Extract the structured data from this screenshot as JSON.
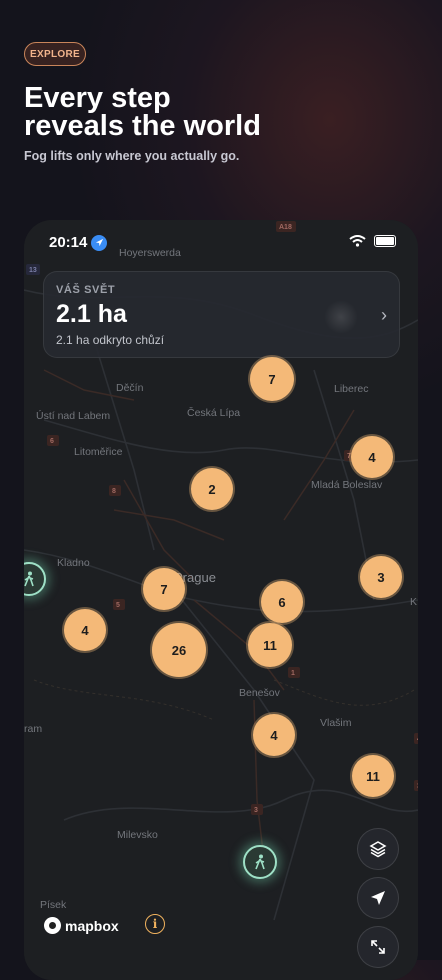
{
  "promo": {
    "badge": "EXPLORE",
    "headline_line1": "Every step",
    "headline_line2": "reveals the world",
    "subline": "Fog lifts only where you actually go."
  },
  "status_bar": {
    "time": "20:14"
  },
  "stats_card": {
    "label": "VÁŠ SVĚT",
    "value": "2.1 ha",
    "sub": "2.1 ha odkryto chůzí"
  },
  "map": {
    "places": [
      "Hoyerswerda",
      "Děčín",
      "Česká Lípa",
      "Liberec",
      "Ústí nad Labem",
      "Litoměřice",
      "Mladá Boleslav",
      "Kladno",
      "Prague",
      "Benešov",
      "Vlašim",
      "Milevsko",
      "Písek",
      "ram",
      "K"
    ],
    "road_labels": [
      "A18",
      "13",
      "6",
      "8",
      "7",
      "5",
      "1",
      "3",
      "4",
      "3"
    ],
    "clusters": [
      "7",
      "4",
      "2",
      "7",
      "3",
      "6",
      "4",
      "26",
      "11",
      "4",
      "11"
    ]
  },
  "attribution": {
    "brand": "mapbox",
    "info_glyph": "i"
  },
  "controls": {
    "layers": "layers-icon",
    "locate": "location-arrow-icon",
    "expand": "expand-icon"
  },
  "colors": {
    "accent": "#f4b978",
    "walker": "#9ee0c6",
    "badge_border": "#c9855a"
  }
}
